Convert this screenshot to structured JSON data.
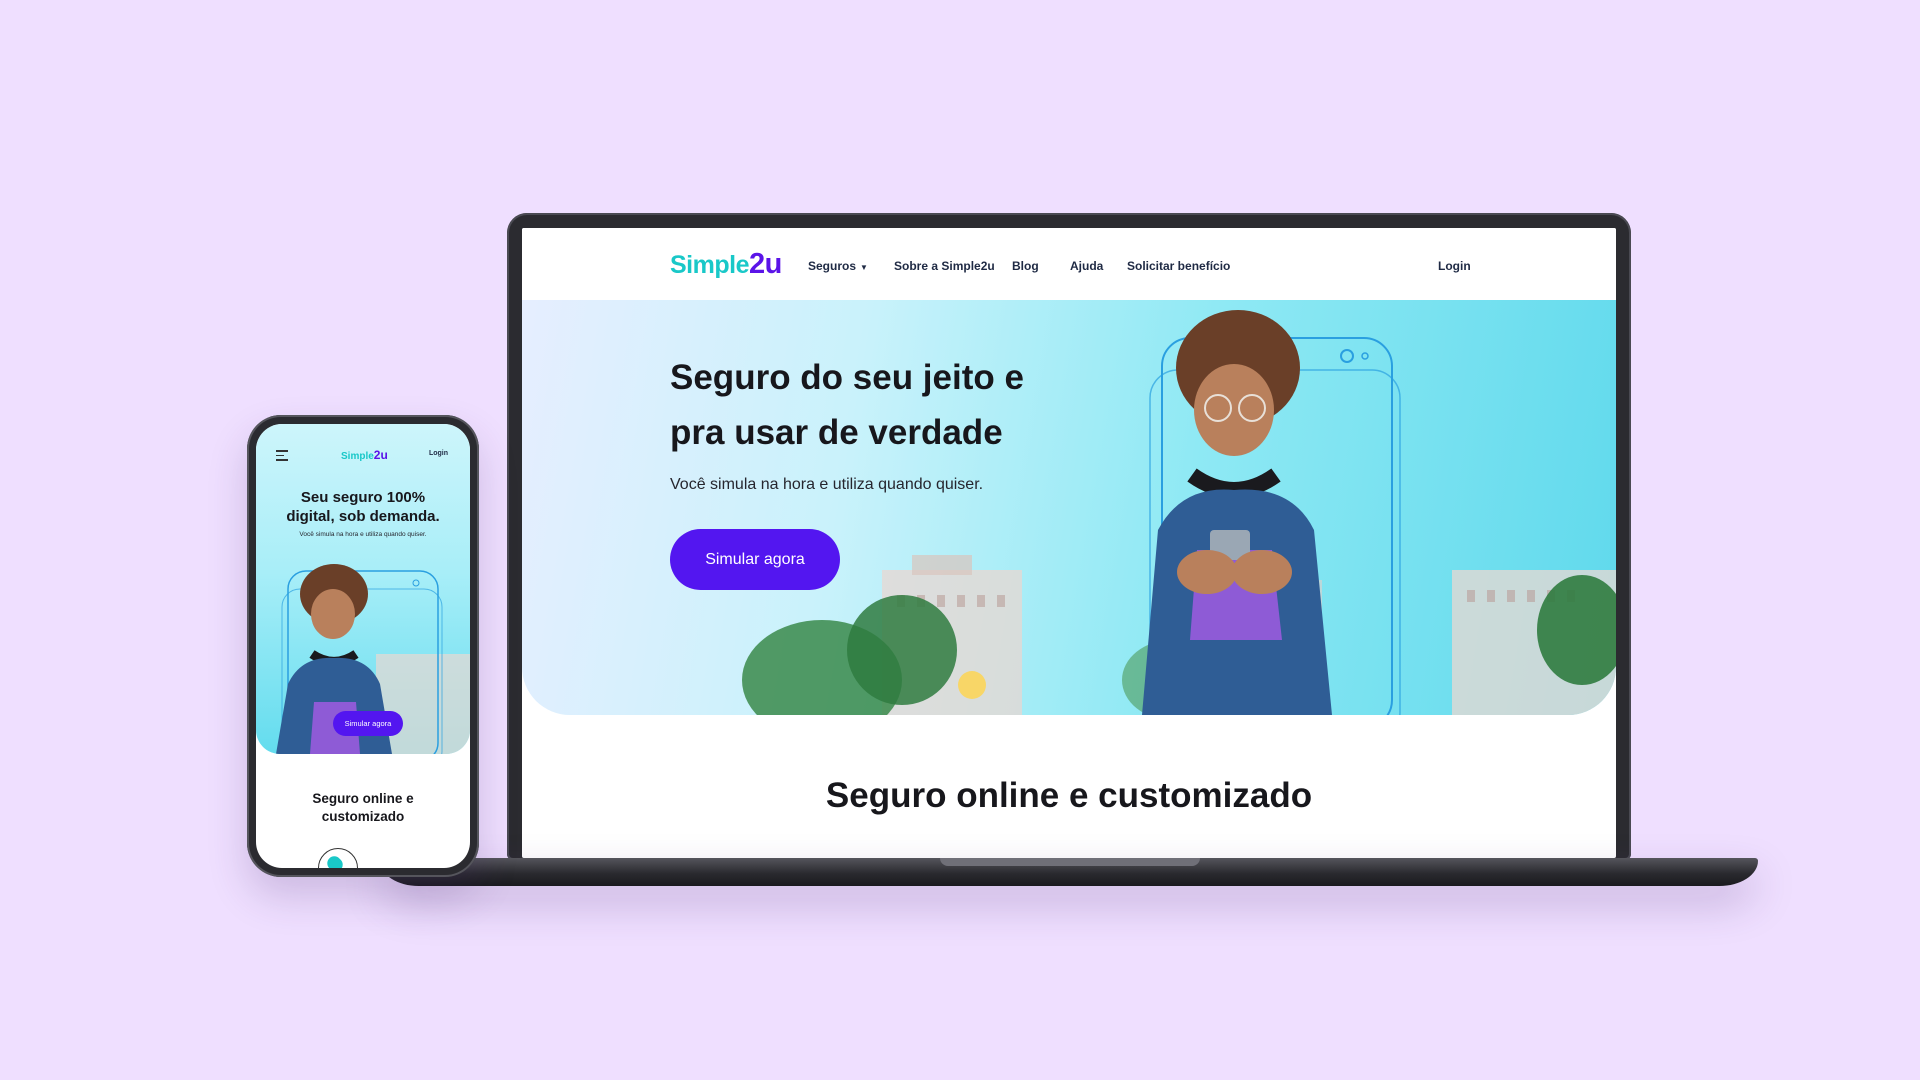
{
  "desktop": {
    "nav": {
      "logo": {
        "text": "Simple",
        "accent": "2u"
      },
      "items": [
        {
          "label": "Seguros",
          "has_dropdown": true
        },
        {
          "label": "Sobre a Simple2u"
        },
        {
          "label": "Blog"
        },
        {
          "label": "Ajuda"
        },
        {
          "label": "Solicitar benefício"
        }
      ],
      "login": "Login"
    },
    "hero": {
      "title": "Seguro do seu jeito e pra usar de verdade",
      "subtitle": "Você simula na hora e utiliza quando quiser.",
      "cta": "Simular agora"
    },
    "section_title": "Seguro online e  customizado"
  },
  "mobile": {
    "nav": {
      "logo": {
        "text": "Simple",
        "accent": "2u"
      },
      "login": "Login"
    },
    "hero": {
      "title": "Seu seguro 100% digital, sob demanda.",
      "subtitle": "Você simula na hora e utiliza quando quiser.",
      "cta": "Simular agora"
    },
    "section_title": "Seguro online e customizado"
  },
  "colors": {
    "background": "#efdfff",
    "brand_teal": "#19c8c8",
    "brand_purple": "#5b14e8",
    "cta": "#5316f0",
    "hero_cyan": "#5fd9ec"
  },
  "icons": [
    "hamburger-menu-icon",
    "dropdown-caret-icon",
    "heart-badge-icon"
  ]
}
